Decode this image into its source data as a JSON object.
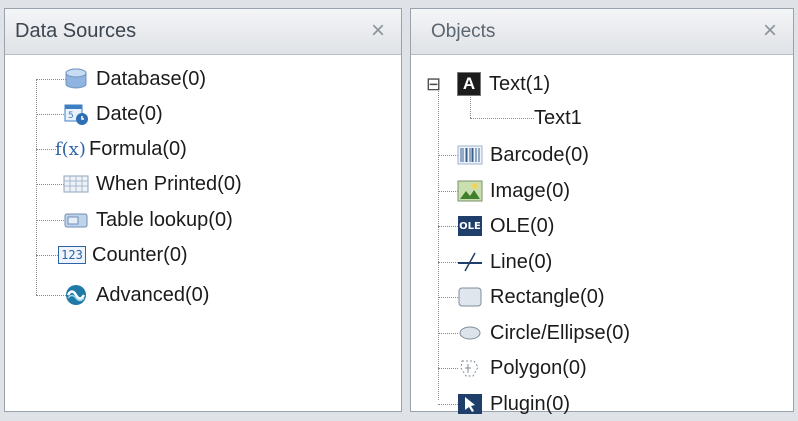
{
  "data_sources": {
    "title": "Data Sources",
    "close_glyph": "×",
    "items": [
      {
        "label": "Database(0)",
        "icon": "database-icon"
      },
      {
        "label": "Date(0)",
        "icon": "calendar-icon"
      },
      {
        "label": "Formula(0)",
        "icon": "formula-icon"
      },
      {
        "label": "When Printed(0)",
        "icon": "grid-icon"
      },
      {
        "label": "Table lookup(0)",
        "icon": "table-lookup-icon"
      },
      {
        "label": "Counter(0)",
        "icon": "counter-icon"
      },
      {
        "label": "Advanced(0)",
        "icon": "advanced-icon"
      }
    ]
  },
  "objects": {
    "title": "Objects",
    "close_glyph": "×",
    "expander_glyph": "⊟",
    "items": [
      {
        "label": "Text(1)",
        "icon": "text-icon",
        "children": [
          {
            "label": "Text1"
          }
        ]
      },
      {
        "label": "Barcode(0)",
        "icon": "barcode-icon"
      },
      {
        "label": "Image(0)",
        "icon": "image-icon"
      },
      {
        "label": "OLE(0)",
        "icon": "ole-icon"
      },
      {
        "label": "Line(0)",
        "icon": "line-icon"
      },
      {
        "label": "Rectangle(0)",
        "icon": "rectangle-icon"
      },
      {
        "label": "Circle/Ellipse(0)",
        "icon": "ellipse-icon"
      },
      {
        "label": "Polygon(0)",
        "icon": "polygon-icon"
      },
      {
        "label": "Plugin(0)",
        "icon": "plugin-icon"
      }
    ]
  },
  "icon_text": {
    "formula": "f(x)",
    "counter": "123",
    "text_letter": "A",
    "ole": "OLE"
  },
  "colors": {
    "accent_blue": "#3e7fc4",
    "tree_line": "#8a8a8a"
  }
}
